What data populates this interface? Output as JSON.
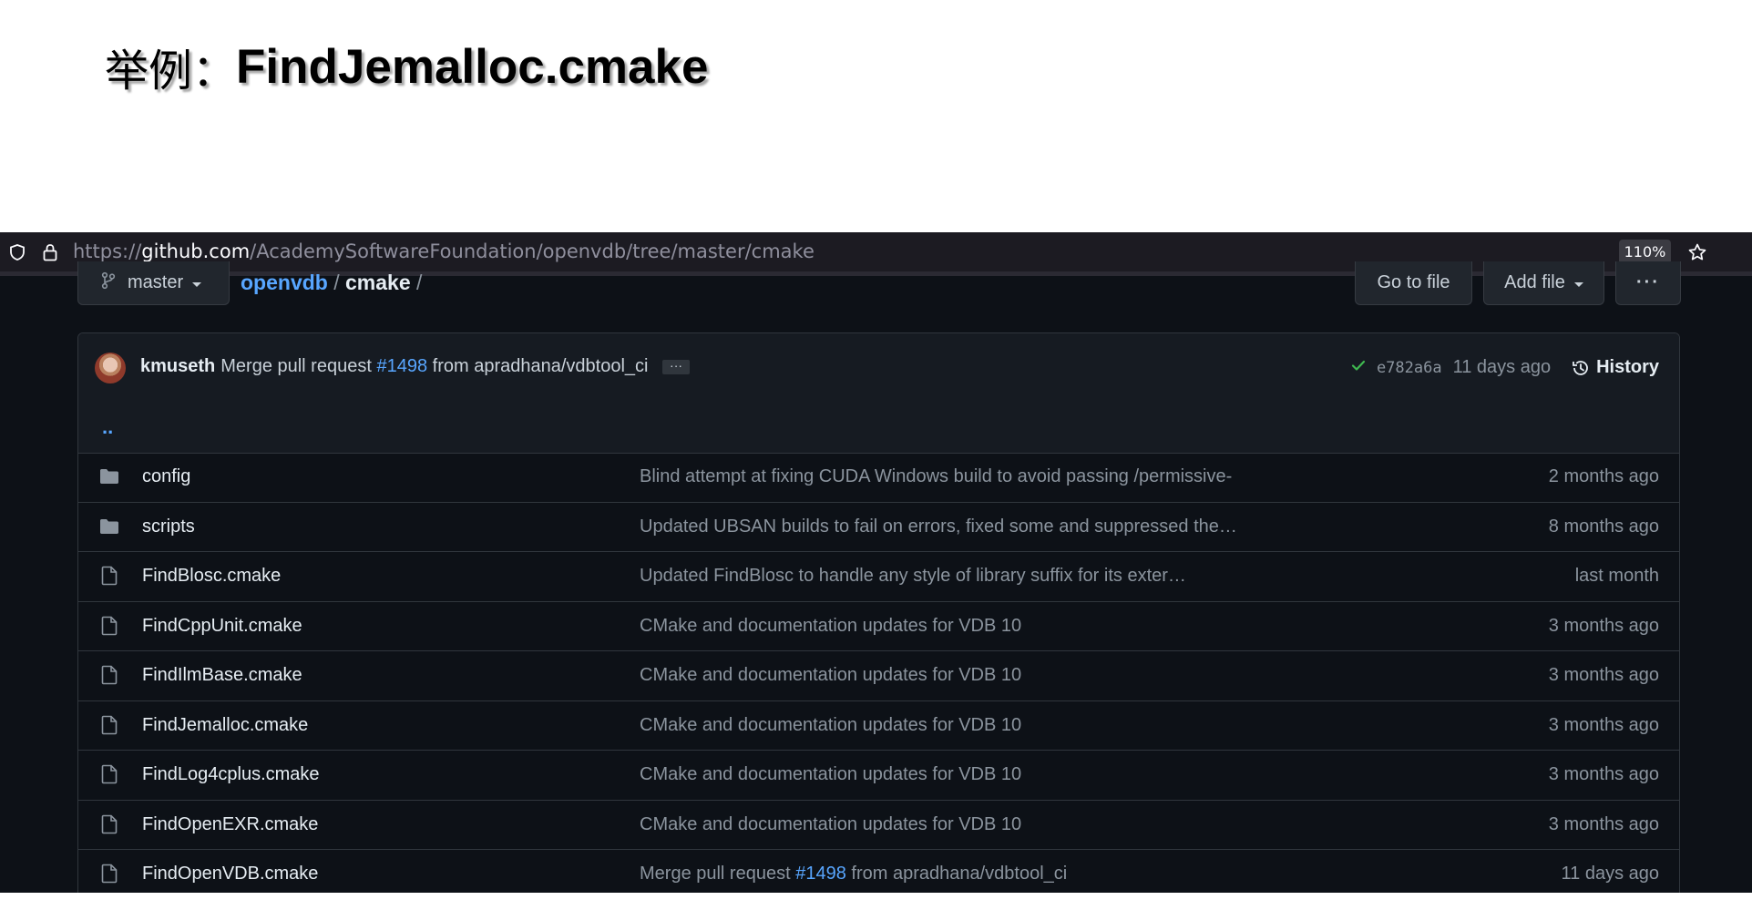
{
  "slide": {
    "title_prefix": "举例：",
    "title_main": "FindJemalloc.cmake"
  },
  "browser": {
    "url_scheme": "https://",
    "url_host": "github.com",
    "url_path": "/AcademySoftwareFoundation/openvdb/tree/master/cmake",
    "zoom": "110%"
  },
  "repo_header": {
    "branch": "master",
    "repo": "openvdb",
    "sep1": "/",
    "dir": "cmake",
    "sep2": "/",
    "go_to_file": "Go to file",
    "add_file": "Add file",
    "more": "···"
  },
  "latest_commit": {
    "author": "kmuseth",
    "message_prefix": "Merge pull request",
    "pr": "#1498",
    "message_suffix": "from apradhana/vdbtool_ci",
    "ellipsis": "···",
    "sha": "e782a6a",
    "age": "11 days ago",
    "history": "History"
  },
  "parent_dir": "..",
  "files": [
    {
      "type": "folder",
      "name": "config",
      "msg": "Blind attempt at fixing CUDA Windows build to avoid passing /permissive-",
      "age": "2 months ago"
    },
    {
      "type": "folder",
      "name": "scripts",
      "msg": "Updated UBSAN builds to fail on errors, fixed some and suppressed the…",
      "age": "8 months ago"
    },
    {
      "type": "file",
      "name": "FindBlosc.cmake",
      "msg": "Updated FindBlosc to handle any style of library suffix for its exter…",
      "age": "last month"
    },
    {
      "type": "file",
      "name": "FindCppUnit.cmake",
      "msg": "CMake and documentation updates for VDB 10",
      "age": "3 months ago"
    },
    {
      "type": "file",
      "name": "FindIlmBase.cmake",
      "msg": "CMake and documentation updates for VDB 10",
      "age": "3 months ago"
    },
    {
      "type": "file",
      "name": "FindJemalloc.cmake",
      "msg": "CMake and documentation updates for VDB 10",
      "age": "3 months ago"
    },
    {
      "type": "file",
      "name": "FindLog4cplus.cmake",
      "msg": "CMake and documentation updates for VDB 10",
      "age": "3 months ago"
    },
    {
      "type": "file",
      "name": "FindOpenEXR.cmake",
      "msg": "CMake and documentation updates for VDB 10",
      "age": "3 months ago"
    },
    {
      "type": "file",
      "name": "FindOpenVDB.cmake",
      "msg_prefix": "Merge pull request",
      "msg_link": "#1498",
      "msg_suffix": "from apradhana/vdbtool_ci",
      "age": "11 days ago"
    }
  ]
}
